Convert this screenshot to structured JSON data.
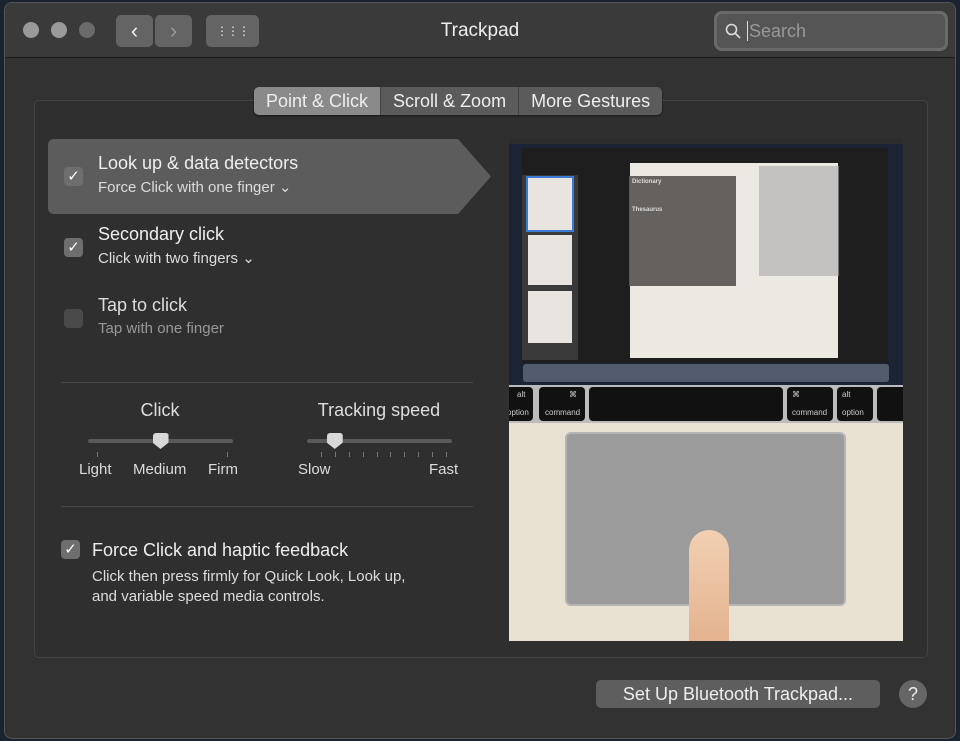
{
  "window": {
    "title": "Trackpad"
  },
  "toolbar": {
    "back_icon": "‹",
    "forward_icon": "›",
    "grid_icon": "⋮⋮⋮",
    "search_placeholder": "Search"
  },
  "tabs": [
    {
      "label": "Point & Click",
      "active": true
    },
    {
      "label": "Scroll & Zoom",
      "active": false
    },
    {
      "label": "More Gestures",
      "active": false
    }
  ],
  "options": [
    {
      "title": "Look up & data detectors",
      "subtitle": "Force Click with one finger ⌄",
      "checked": true,
      "selected": true
    },
    {
      "title": "Secondary click",
      "subtitle": "Click with two fingers ⌄",
      "checked": true,
      "selected": false
    },
    {
      "title": "Tap to click",
      "subtitle": "Tap with one finger",
      "checked": false,
      "selected": false
    }
  ],
  "sliders": {
    "click": {
      "label": "Click",
      "min_label": "Light",
      "mid_label": "Medium",
      "max_label": "Firm",
      "value": 0.5
    },
    "tracking": {
      "label": "Tracking speed",
      "min_label": "Slow",
      "max_label": "Fast",
      "value": 0.11
    }
  },
  "force_click": {
    "title": "Force Click and haptic feedback",
    "description_line1": "Click then press firmly for Quick Look, Look up,",
    "description_line2": "and variable speed media controls.",
    "checked": true
  },
  "preview": {
    "keys": {
      "left_option_alt": "alt",
      "left_option": "option",
      "left_command_symbol": "⌘",
      "left_command": "command",
      "right_command_symbol": "⌘",
      "right_command": "command",
      "right_option_alt": "alt",
      "right_option": "option"
    },
    "popup_dictionary": "Dictionary",
    "popup_thesaurus": "Thesaurus"
  },
  "footer": {
    "setup_button": "Set Up Bluetooth Trackpad...",
    "help_button": "?"
  }
}
